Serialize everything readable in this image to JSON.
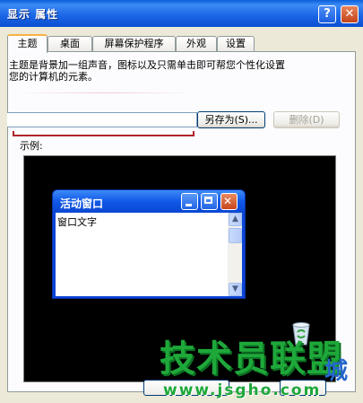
{
  "window": {
    "title": "显示 属性",
    "help_glyph": "?",
    "close_glyph": "✕"
  },
  "tabs": [
    {
      "label": "主题",
      "active": true
    },
    {
      "label": "桌面",
      "active": false
    },
    {
      "label": "屏幕保护程序",
      "active": false
    },
    {
      "label": "外观",
      "active": false
    },
    {
      "label": "设置",
      "active": false
    }
  ],
  "themes": {
    "description_line1": "主题是背景加一组声音，图标以及只需单击即可帮您个性化设置",
    "description_line2": "您的计算机的元素。",
    "selected_value": "",
    "save_as_label": "另存为(S)...",
    "delete_label": "删除(D)"
  },
  "preview": {
    "label": "示例:",
    "window_title": "活动窗口",
    "window_text": "窗口文字",
    "scroll_up_glyph": "▲",
    "scroll_down_glyph": "▼"
  },
  "watermark": {
    "text": "技术员联盟",
    "side_text": "城",
    "url": "www.jsgho.com"
  },
  "colors": {
    "title_bar": "#1a64e6",
    "active_tab_accent": "#f9b341",
    "highlight_red": "#b0252a",
    "preview_bg": "#000000"
  }
}
